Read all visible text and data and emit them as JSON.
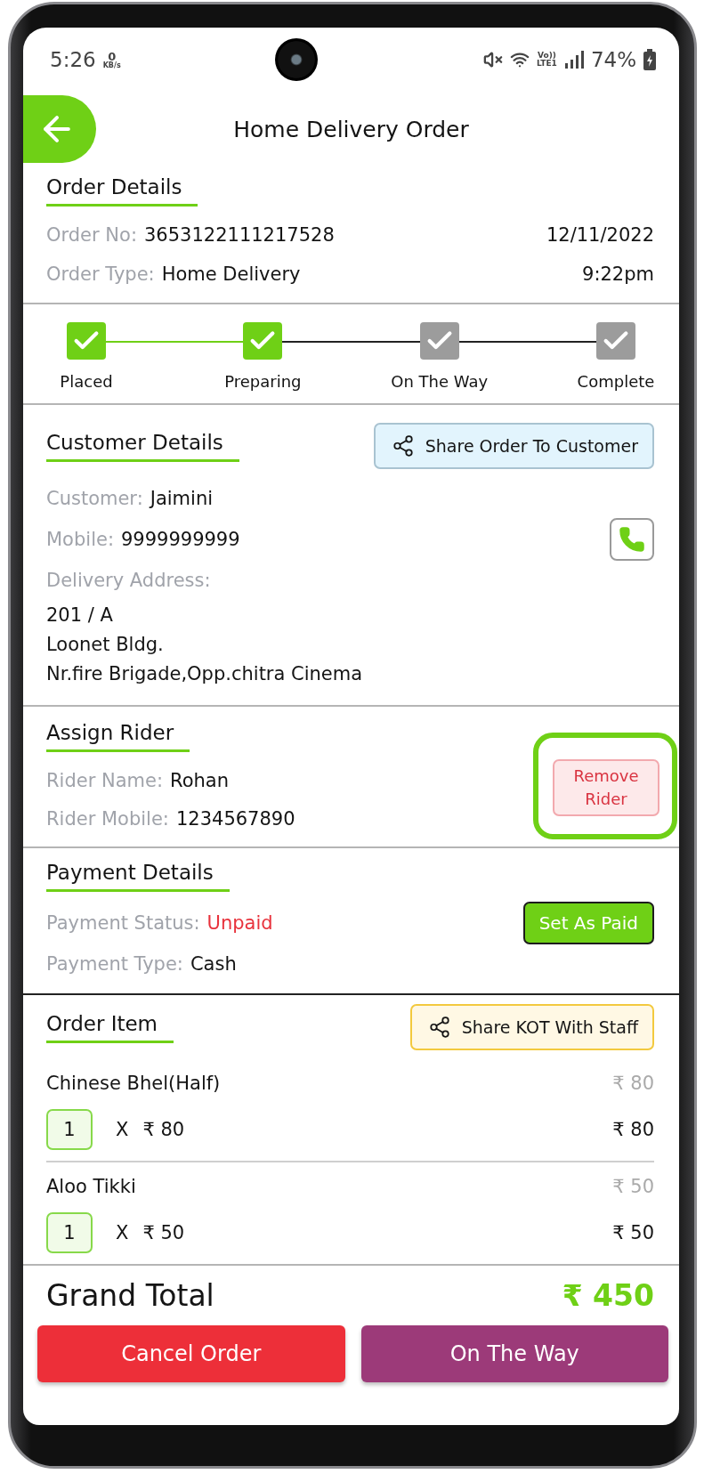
{
  "status_bar": {
    "time": "5:26",
    "net_speed": "0",
    "net_unit": "KB/s",
    "network_top": "Vo))",
    "network_bottom": "LTE1",
    "battery": "74%"
  },
  "header": {
    "title": "Home Delivery Order"
  },
  "order_details": {
    "heading": "Order Details",
    "rows": [
      {
        "label": "Order No:",
        "value": "3653122111217528",
        "aside": "12/11/2022"
      },
      {
        "label": "Order Type:",
        "value": "Home Delivery",
        "aside": "9:22pm"
      }
    ]
  },
  "steps": [
    {
      "label": "Placed",
      "done": true
    },
    {
      "label": "Preparing",
      "done": true
    },
    {
      "label": "On The Way",
      "done": false
    },
    {
      "label": "Complete",
      "done": false
    }
  ],
  "customer": {
    "heading": "Customer Details",
    "share_button": "Share Order To Customer",
    "fields": [
      {
        "label": "Customer:",
        "value": "Jaimini"
      },
      {
        "label": "Mobile:",
        "value": "9999999999"
      }
    ],
    "address_label": "Delivery Address:",
    "address_lines": [
      "201 / A",
      "Loonet Bldg.",
      "Nr.fire Brigade,Opp.chitra Cinema"
    ]
  },
  "rider": {
    "heading": "Assign Rider",
    "fields": [
      {
        "label": "Rider Name:",
        "value": "Rohan"
      },
      {
        "label": "Rider Mobile:",
        "value": "1234567890"
      }
    ],
    "remove_button": "Remove Rider",
    "highlighted": true
  },
  "payment": {
    "heading": "Payment Details",
    "status_label": "Payment Status:",
    "status": "Unpaid",
    "paid": false,
    "set_paid_button": "Set As Paid",
    "type_label": "Payment Type:",
    "type": "Cash"
  },
  "order_items": {
    "heading": "Order Item",
    "share_button": "Share KOT With Staff",
    "items": [
      {
        "name": "Chinese Bhel(Half)",
        "price": "₹ 80",
        "qty": "1",
        "multiplier": "X",
        "unit_price": "₹ 80",
        "line_total": "₹ 80"
      },
      {
        "name": "Aloo Tikki",
        "price": "₹ 50",
        "qty": "1",
        "multiplier": "X",
        "unit_price": "₹ 50",
        "line_total": "₹ 50"
      }
    ]
  },
  "total": {
    "label": "Grand Total",
    "amount": "₹ 450"
  },
  "actions": [
    {
      "label": "Cancel Order",
      "kind": "cancel"
    },
    {
      "label": "On The Way",
      "kind": "advance"
    }
  ]
}
